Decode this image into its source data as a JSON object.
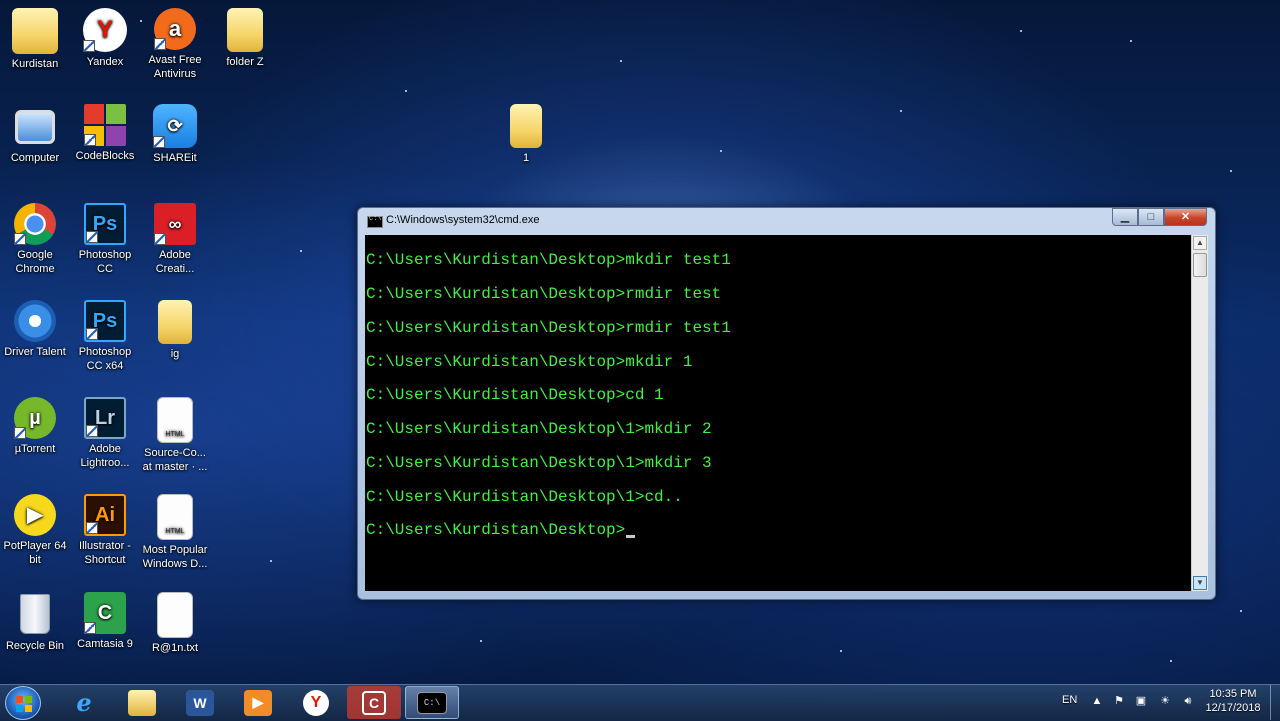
{
  "desktop": {
    "icons": [
      {
        "label": "Kurdistan",
        "icon": "user-folder-icon"
      },
      {
        "label": "Yandex",
        "icon": "yandex-icon"
      },
      {
        "label": "Avast Free Antivirus",
        "icon": "avast-icon"
      },
      {
        "label": "folder Z",
        "icon": "folder-icon"
      },
      {
        "label": "Computer",
        "icon": "computer-icon"
      },
      {
        "label": "CodeBlocks",
        "icon": "codeblocks-icon"
      },
      {
        "label": "SHAREit",
        "icon": "shareit-icon"
      },
      {
        "label": "1",
        "icon": "folder-icon"
      },
      {
        "label": "Google Chrome",
        "icon": "chrome-icon"
      },
      {
        "label": "Photoshop CC",
        "icon": "photoshop-icon"
      },
      {
        "label": "Adobe Creati...",
        "icon": "creative-cloud-icon"
      },
      {
        "label": "Driver Talent",
        "icon": "driver-talent-icon"
      },
      {
        "label": "Photoshop CC x64",
        "icon": "photoshop-icon"
      },
      {
        "label": "ig",
        "icon": "folder-icon"
      },
      {
        "label": "µTorrent",
        "icon": "utorrent-icon"
      },
      {
        "label": "Adobe Lightroo...",
        "icon": "lightroom-icon"
      },
      {
        "label": "Source-Co... at master · ...",
        "icon": "html-file-icon"
      },
      {
        "label": "PotPlayer 64 bit",
        "icon": "potplayer-icon"
      },
      {
        "label": "Illustrator - Shortcut",
        "icon": "illustrator-icon"
      },
      {
        "label": "Most Popular Windows D...",
        "icon": "html-file-icon"
      },
      {
        "label": "Recycle Bin",
        "icon": "recycle-bin-icon"
      },
      {
        "label": "Camtasia 9",
        "icon": "camtasia-icon"
      },
      {
        "label": "R@1n.txt",
        "icon": "text-file-icon"
      }
    ]
  },
  "cmd": {
    "title": "C:\\Windows\\system32\\cmd.exe",
    "lines": [
      "C:\\Users\\Kurdistan\\Desktop>mkdir test1",
      "C:\\Users\\Kurdistan\\Desktop>rmdir test",
      "C:\\Users\\Kurdistan\\Desktop>rmdir test1",
      "C:\\Users\\Kurdistan\\Desktop>mkdir 1",
      "C:\\Users\\Kurdistan\\Desktop>cd 1",
      "C:\\Users\\Kurdistan\\Desktop\\1>mkdir 2",
      "C:\\Users\\Kurdistan\\Desktop\\1>mkdir 3",
      "C:\\Users\\Kurdistan\\Desktop\\1>cd..",
      "C:\\Users\\Kurdistan\\Desktop>"
    ],
    "text_color": "#3ef23e"
  },
  "taskbar": {
    "apps": [
      "internet-explorer-icon",
      "file-explorer-icon",
      "word-icon",
      "media-player-icon",
      "yandex-icon",
      "camtasia-icon",
      "cmd-icon"
    ],
    "language": "EN",
    "time": "10:35 PM",
    "date": "12/17/2018"
  }
}
